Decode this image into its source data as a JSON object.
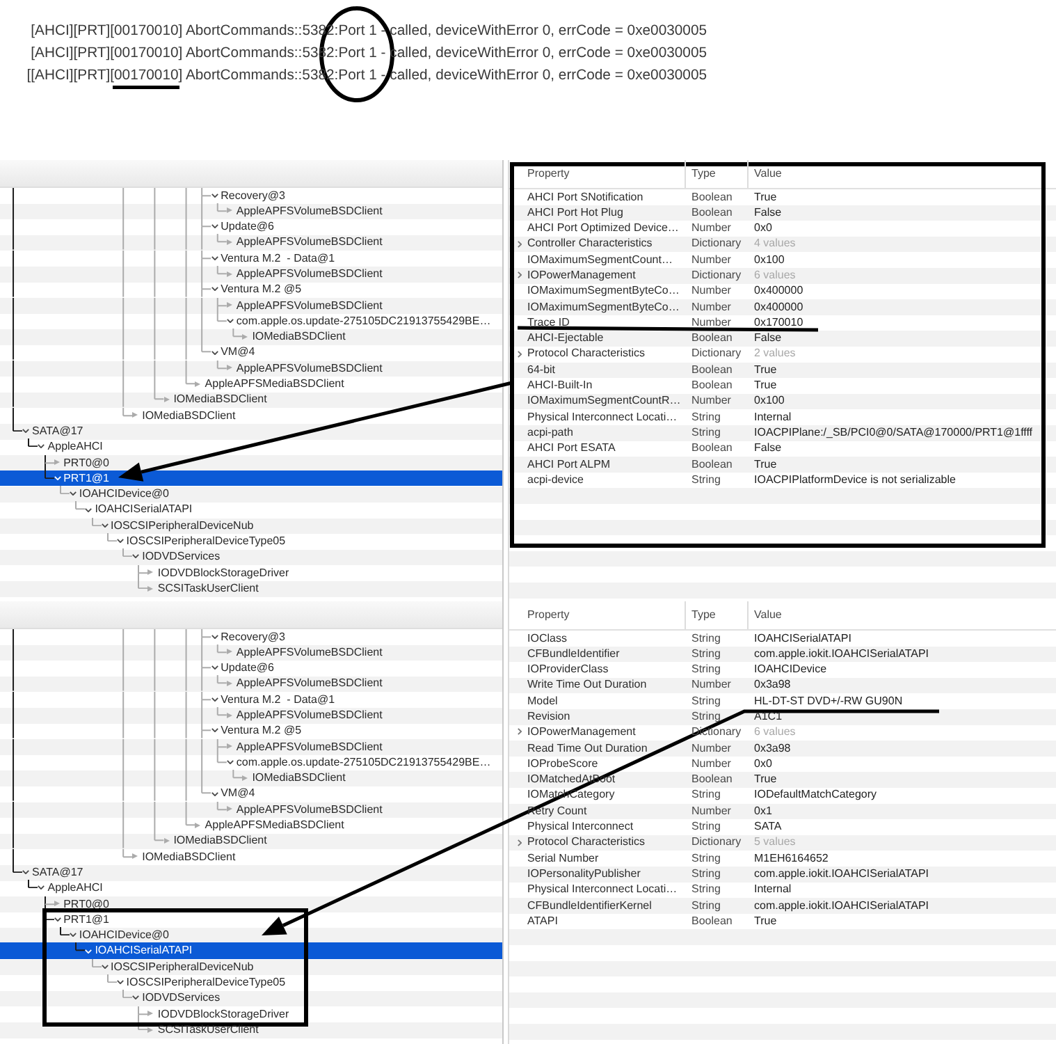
{
  "log": {
    "lines": [
      "[AHCI][PRT][00170010] AbortCommands::5382:Port 1 - called, deviceWithError 0, errCode = 0xe0030005",
      "[AHCI][PRT][00170010] AbortCommands::5382:Port 1 - called, deviceWithError 0, errCode = 0xe0030005",
      "[[AHCI][PRT][00170010] AbortCommands::5382:Port 1 - called, deviceWithError 0, errCode = 0xe0030005"
    ],
    "annotations": [
      {
        "kind": "ellipse"
      },
      {
        "kind": "underline"
      }
    ]
  },
  "panels": [
    {
      "tree": [
        {
          "children": [
            {
              "children": [
                {
                  "children": [
                    {
                      "children": [
                        {
                          "children": [
                            {
                              "children": [
                                {
                                  "children": [
                                    {
                                      "children": [
                                        {
                                          "children": [
                                            {
                                              "children": [
                                                {
                                                  "children": [
                                                    {
                                                      "children": [
                                                        {
                                                          "label": "Recovery@3",
                                                          "selected": false,
                                                          "expanded": true,
                                                          "children": [
                                                            {
                                                              "label": "AppleAPFSVolumeBSDClient",
                                                              "selected": false
                                                            }
                                                          ]
                                                        },
                                                        {
                                                          "label": "Update@6",
                                                          "selected": false,
                                                          "expanded": true,
                                                          "children": [
                                                            {
                                                              "label": "AppleAPFSVolumeBSDClient",
                                                              "selected": false
                                                            }
                                                          ]
                                                        },
                                                        {
                                                          "label": "Ventura M.2  - Data@1",
                                                          "selected": false,
                                                          "expanded": true,
                                                          "children": [
                                                            {
                                                              "label": "AppleAPFSVolumeBSDClient",
                                                              "selected": false
                                                            }
                                                          ]
                                                        },
                                                        {
                                                          "label": "Ventura M.2 @5",
                                                          "selected": false,
                                                          "expanded": true,
                                                          "children": [
                                                            {
                                                              "label": "AppleAPFSVolumeBSDClient",
                                                              "selected": false
                                                            },
                                                            {
                                                              "label": "com.apple.os.update-275105DC21913755429BE…",
                                                              "selected": false,
                                                              "expanded": true,
                                                              "children": [
                                                                {
                                                                  "label": "IOMediaBSDClient",
                                                                  "selected": false
                                                                }
                                                              ]
                                                            }
                                                          ]
                                                        },
                                                        {
                                                          "label": "VM@4",
                                                          "selected": false,
                                                          "expanded": true,
                                                          "children": [
                                                            {
                                                              "label": "AppleAPFSVolumeBSDClient",
                                                              "selected": false
                                                            }
                                                          ]
                                                        }
                                                      ]
                                                    },
                                                    {
                                                      "label": "AppleAPFSMediaBSDClient",
                                                      "selected": false
                                                    }
                                                  ]
                                                }
                                              ]
                                            },
                                            {
                                              "label": "IOMediaBSDClient",
                                              "selected": false
                                            }
                                          ]
                                        }
                                      ]
                                    },
                                    {
                                      "label": "IOMediaBSDClient",
                                      "selected": false
                                    }
                                  ]
                                }
                              ]
                            }
                          ]
                        }
                      ]
                    }
                  ]
                }
              ]
            }
          ]
        },
        {
          "label": "SATA@17",
          "selected": false,
          "expanded": true,
          "children": [
            {
              "label": "AppleAHCI",
              "selected": false,
              "expanded": true,
              "children": [
                {
                  "label": "PRT0@0",
                  "selected": false
                },
                {
                  "label": "PRT1@1",
                  "selected": true,
                  "expanded": true,
                  "children": [
                    {
                      "label": "IOAHCIDevice@0",
                      "selected": false,
                      "expanded": true,
                      "children": [
                        {
                          "label": "IOAHCISerialATAPI",
                          "selected": false,
                          "expanded": true,
                          "children": [
                            {
                              "label": "IOSCSIPeripheralDeviceNub",
                              "selected": false,
                              "expanded": true,
                              "children": [
                                {
                                  "label": "IOSCSIPeripheralDeviceType05",
                                  "selected": false,
                                  "expanded": true,
                                  "children": [
                                    {
                                      "label": "IODVDServices",
                                      "selected": false,
                                      "expanded": true,
                                      "children": [
                                        {
                                          "label": "IODVDBlockStorageDriver",
                                          "selected": false
                                        },
                                        {
                                          "label": "SCSITaskUserClient",
                                          "selected": false
                                        }
                                      ]
                                    }
                                  ]
                                }
                              ]
                            }
                          ]
                        }
                      ]
                    }
                  ]
                }
              ]
            }
          ]
        }
      ],
      "properties": {
        "columns": [
          "Property",
          "Type",
          "Value"
        ],
        "rows": [
          {
            "kind": "scalar",
            "property": "AHCI Port SNotification",
            "type": "Boolean",
            "value": "True"
          },
          {
            "kind": "scalar",
            "property": "AHCI Port Hot Plug",
            "type": "Boolean",
            "value": "False"
          },
          {
            "kind": "scalar",
            "property": "AHCI Port Optimized Device…",
            "type": "Number",
            "value": "0x0"
          },
          {
            "kind": "dictionary",
            "property": "Controller Characteristics",
            "type": "Dictionary",
            "value": "4 values"
          },
          {
            "kind": "scalar",
            "property": "IOMaximumSegmentCount…",
            "type": "Number",
            "value": "0x100"
          },
          {
            "kind": "dictionary",
            "property": "IOPowerManagement",
            "type": "Dictionary",
            "value": "6 values"
          },
          {
            "kind": "scalar",
            "property": "IOMaximumSegmentByteCo…",
            "type": "Number",
            "value": "0x400000"
          },
          {
            "kind": "scalar",
            "property": "IOMaximumSegmentByteCo…",
            "type": "Number",
            "value": "0x400000"
          },
          {
            "kind": "scalar",
            "property": "Trace ID",
            "type": "Number",
            "value": "0x170010"
          },
          {
            "kind": "scalar",
            "property": "AHCI-Ejectable",
            "type": "Boolean",
            "value": "False"
          },
          {
            "kind": "dictionary",
            "property": "Protocol Characteristics",
            "type": "Dictionary",
            "value": "2 values"
          },
          {
            "kind": "scalar",
            "property": "64-bit",
            "type": "Boolean",
            "value": "True"
          },
          {
            "kind": "scalar",
            "property": "AHCI-Built-In",
            "type": "Boolean",
            "value": "True"
          },
          {
            "kind": "scalar",
            "property": "IOMaximumSegmentCountR…",
            "type": "Number",
            "value": "0x100"
          },
          {
            "kind": "scalar",
            "property": "Physical Interconnect Locati…",
            "type": "String",
            "value": "Internal"
          },
          {
            "kind": "scalar",
            "property": "acpi-path",
            "type": "String",
            "value": "IOACPIPlane:/_SB/PCI0@0/SATA@170000/PRT1@1ffff"
          },
          {
            "kind": "scalar",
            "property": "AHCI Port ESATA",
            "type": "Boolean",
            "value": "False"
          },
          {
            "kind": "scalar",
            "property": "AHCI Port ALPM",
            "type": "Boolean",
            "value": "True"
          },
          {
            "kind": "scalar",
            "property": "acpi-device",
            "type": "String",
            "value": "IOACPIPlatformDevice is not serializable"
          }
        ]
      },
      "annotations": [
        {
          "kind": "box"
        },
        {
          "kind": "line"
        },
        {
          "kind": "arrow"
        }
      ]
    },
    {
      "tree": [
        {
          "children": [
            {
              "children": [
                {
                  "children": [
                    {
                      "children": [
                        {
                          "children": [
                            {
                              "children": [
                                {
                                  "children": [
                                    {
                                      "children": [
                                        {
                                          "children": [
                                            {
                                              "children": [
                                                {
                                                  "children": [
                                                    {
                                                      "children": [
                                                        {
                                                          "label": "Recovery@3",
                                                          "selected": false,
                                                          "expanded": true,
                                                          "children": [
                                                            {
                                                              "label": "AppleAPFSVolumeBSDClient",
                                                              "selected": false
                                                            }
                                                          ]
                                                        },
                                                        {
                                                          "label": "Update@6",
                                                          "selected": false,
                                                          "expanded": true,
                                                          "children": [
                                                            {
                                                              "label": "AppleAPFSVolumeBSDClient",
                                                              "selected": false
                                                            }
                                                          ]
                                                        },
                                                        {
                                                          "label": "Ventura M.2  - Data@1",
                                                          "selected": false,
                                                          "expanded": true,
                                                          "children": [
                                                            {
                                                              "label": "AppleAPFSVolumeBSDClient",
                                                              "selected": false
                                                            }
                                                          ]
                                                        },
                                                        {
                                                          "label": "Ventura M.2 @5",
                                                          "selected": false,
                                                          "expanded": true,
                                                          "children": [
                                                            {
                                                              "label": "AppleAPFSVolumeBSDClient",
                                                              "selected": false
                                                            },
                                                            {
                                                              "label": "com.apple.os.update-275105DC21913755429BE…",
                                                              "selected": false,
                                                              "expanded": true,
                                                              "children": [
                                                                {
                                                                  "label": "IOMediaBSDClient",
                                                                  "selected": false
                                                                }
                                                              ]
                                                            }
                                                          ]
                                                        },
                                                        {
                                                          "label": "VM@4",
                                                          "selected": false,
                                                          "expanded": true,
                                                          "children": [
                                                            {
                                                              "label": "AppleAPFSVolumeBSDClient",
                                                              "selected": false
                                                            }
                                                          ]
                                                        }
                                                      ]
                                                    },
                                                    {
                                                      "label": "AppleAPFSMediaBSDClient",
                                                      "selected": false
                                                    }
                                                  ]
                                                }
                                              ]
                                            },
                                            {
                                              "label": "IOMediaBSDClient",
                                              "selected": false
                                            }
                                          ]
                                        }
                                      ]
                                    },
                                    {
                                      "label": "IOMediaBSDClient",
                                      "selected": false
                                    }
                                  ]
                                }
                              ]
                            }
                          ]
                        }
                      ]
                    }
                  ]
                }
              ]
            }
          ]
        },
        {
          "label": "SATA@17",
          "selected": false,
          "expanded": true,
          "children": [
            {
              "label": "AppleAHCI",
              "selected": false,
              "expanded": true,
              "children": [
                {
                  "label": "PRT0@0",
                  "selected": false
                },
                {
                  "label": "PRT1@1",
                  "selected": false,
                  "expanded": true,
                  "children": [
                    {
                      "label": "IOAHCIDevice@0",
                      "selected": false,
                      "expanded": true,
                      "children": [
                        {
                          "label": "IOAHCISerialATAPI",
                          "selected": true,
                          "expanded": true,
                          "children": [
                            {
                              "label": "IOSCSIPeripheralDeviceNub",
                              "selected": false,
                              "expanded": true,
                              "children": [
                                {
                                  "label": "IOSCSIPeripheralDeviceType05",
                                  "selected": false,
                                  "expanded": true,
                                  "children": [
                                    {
                                      "label": "IODVDServices",
                                      "selected": false,
                                      "expanded": true,
                                      "children": [
                                        {
                                          "label": "IODVDBlockStorageDriver",
                                          "selected": false
                                        },
                                        {
                                          "label": "SCSITaskUserClient",
                                          "selected": false
                                        }
                                      ]
                                    }
                                  ]
                                }
                              ]
                            }
                          ]
                        }
                      ]
                    }
                  ]
                }
              ]
            }
          ]
        }
      ],
      "properties": {
        "columns": [
          "Property",
          "Type",
          "Value"
        ],
        "rows": [
          {
            "kind": "scalar",
            "property": "IOClass",
            "type": "String",
            "value": "IOAHCISerialATAPI"
          },
          {
            "kind": "scalar",
            "property": "CFBundleIdentifier",
            "type": "String",
            "value": "com.apple.iokit.IOAHCISerialATAPI"
          },
          {
            "kind": "scalar",
            "property": "IOProviderClass",
            "type": "String",
            "value": "IOAHCIDevice"
          },
          {
            "kind": "scalar",
            "property": "Write Time Out Duration",
            "type": "Number",
            "value": "0x3a98"
          },
          {
            "kind": "scalar",
            "property": "Model",
            "type": "String",
            "value": "HL-DT-ST DVD+/-RW GU90N"
          },
          {
            "kind": "scalar",
            "property": "Revision",
            "type": "String",
            "value": "A1C1"
          },
          {
            "kind": "dictionary",
            "property": "IOPowerManagement",
            "type": "Dictionary",
            "value": "6 values"
          },
          {
            "kind": "scalar",
            "property": "Read Time Out Duration",
            "type": "Number",
            "value": "0x3a98"
          },
          {
            "kind": "scalar",
            "property": "IOProbeScore",
            "type": "Number",
            "value": "0x0"
          },
          {
            "kind": "scalar",
            "property": "IOMatchedAtBoot",
            "type": "Boolean",
            "value": "True"
          },
          {
            "kind": "scalar",
            "property": "IOMatchCategory",
            "type": "String",
            "value": "IODefaultMatchCategory"
          },
          {
            "kind": "scalar",
            "property": "Retry Count",
            "type": "Number",
            "value": "0x1"
          },
          {
            "kind": "scalar",
            "property": "Physical Interconnect",
            "type": "String",
            "value": "SATA"
          },
          {
            "kind": "dictionary",
            "property": "Protocol Characteristics",
            "type": "Dictionary",
            "value": "5 values"
          },
          {
            "kind": "scalar",
            "property": "Serial Number",
            "type": "String",
            "value": "M1EH6164652"
          },
          {
            "kind": "scalar",
            "property": "IOPersonalityPublisher",
            "type": "String",
            "value": "com.apple.iokit.IOAHCISerialATAPI"
          },
          {
            "kind": "scalar",
            "property": "Physical Interconnect Locati…",
            "type": "String",
            "value": "Internal"
          },
          {
            "kind": "scalar",
            "property": "CFBundleIdentifierKernel",
            "type": "String",
            "value": "com.apple.iokit.IOAHCISerialATAPI"
          },
          {
            "kind": "scalar",
            "property": "ATAPI",
            "type": "Boolean",
            "value": "True"
          }
        ]
      },
      "annotations": [
        {
          "kind": "arrow"
        },
        {
          "kind": "box"
        }
      ]
    }
  ]
}
